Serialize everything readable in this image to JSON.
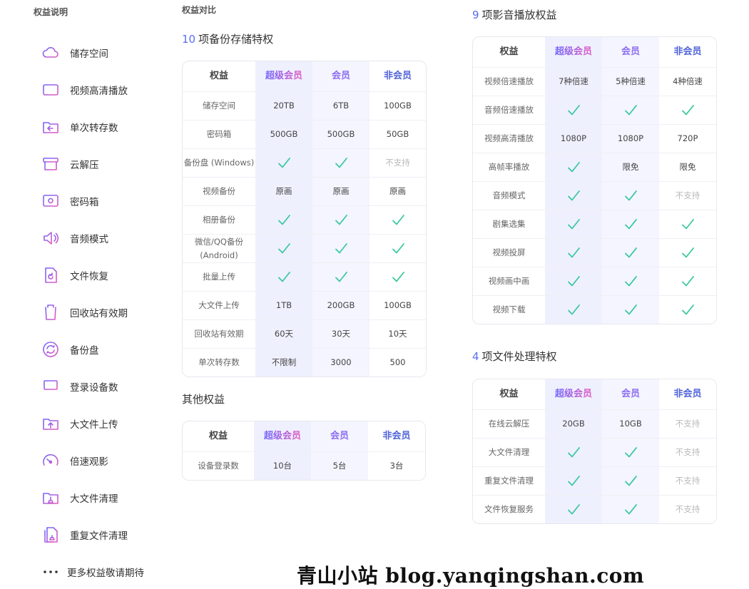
{
  "sidebar": {
    "title": "权益说明",
    "items": [
      {
        "icon": "cloud-icon",
        "label": "储存空间"
      },
      {
        "icon": "video-screen-icon",
        "label": "视频高清播放"
      },
      {
        "icon": "folder-transfer-icon",
        "label": "单次转存数"
      },
      {
        "icon": "archive-box-icon",
        "label": "云解压"
      },
      {
        "icon": "safe-box-icon",
        "label": "密码箱"
      },
      {
        "icon": "speaker-icon",
        "label": "音频模式"
      },
      {
        "icon": "file-restore-icon",
        "label": "文件恢复"
      },
      {
        "icon": "trash-icon",
        "label": "回收站有效期"
      },
      {
        "icon": "sync-icon",
        "label": "备份盘"
      },
      {
        "icon": "laptop-icon",
        "label": "登录设备数"
      },
      {
        "icon": "folder-upload-icon",
        "label": "大文件上传"
      },
      {
        "icon": "speedometer-icon",
        "label": "倍速观影"
      },
      {
        "icon": "folder-clean-icon",
        "label": "大文件清理"
      },
      {
        "icon": "file-duplicate-icon",
        "label": "重复文件清理"
      }
    ],
    "more": {
      "icon": "more-dots-icon",
      "label": "更多权益敬请期待"
    }
  },
  "compare": {
    "title": "权益对比",
    "headers": {
      "c0": "权益",
      "c1": "超级会员",
      "c2": "会员",
      "c3": "非会员"
    }
  },
  "storage": {
    "num": "10",
    "title": "项备份存储特权",
    "rows": [
      {
        "name": "储存空间",
        "v": [
          "20TB",
          "6TB",
          "100GB"
        ]
      },
      {
        "name": "密码箱",
        "v": [
          "500GB",
          "500GB",
          "50GB"
        ]
      },
      {
        "name": "备份盘 (Windows)",
        "v": [
          "✓",
          "✓",
          "不支持"
        ]
      },
      {
        "name": "视频备份",
        "v": [
          "原画",
          "原画",
          "原画"
        ]
      },
      {
        "name": "相册备份",
        "v": [
          "✓",
          "✓",
          "✓"
        ]
      },
      {
        "name": "微信/QQ备份\n(Android)",
        "v": [
          "✓",
          "✓",
          "✓"
        ]
      },
      {
        "name": "批量上传",
        "v": [
          "✓",
          "✓",
          "✓"
        ]
      },
      {
        "name": "大文件上传",
        "v": [
          "1TB",
          "200GB",
          "100GB"
        ]
      },
      {
        "name": "回收站有效期",
        "v": [
          "60天",
          "30天",
          "10天"
        ]
      },
      {
        "name": "单次转存数",
        "v": [
          "不限制",
          "3000",
          "500"
        ]
      }
    ]
  },
  "other": {
    "title": "其他权益",
    "rows": [
      {
        "name": "设备登录数",
        "v": [
          "10台",
          "5台",
          "3台"
        ]
      }
    ]
  },
  "media": {
    "num": "9",
    "title": "项影音播放权益",
    "rows": [
      {
        "name": "视频倍速播放",
        "v": [
          "7种倍速",
          "5种倍速",
          "4种倍速"
        ]
      },
      {
        "name": "音频倍速播放",
        "v": [
          "✓",
          "✓",
          "✓"
        ]
      },
      {
        "name": "视频高清播放",
        "v": [
          "1080P",
          "1080P",
          "720P"
        ]
      },
      {
        "name": "高帧率播放",
        "v": [
          "✓",
          "限免",
          "限免"
        ]
      },
      {
        "name": "音频模式",
        "v": [
          "✓",
          "✓",
          "不支持"
        ]
      },
      {
        "name": "剧集选集",
        "v": [
          "✓",
          "✓",
          "✓"
        ]
      },
      {
        "name": "视频投屏",
        "v": [
          "✓",
          "✓",
          "✓"
        ]
      },
      {
        "name": "视频画中画",
        "v": [
          "✓",
          "✓",
          "✓"
        ]
      },
      {
        "name": "视频下载",
        "v": [
          "✓",
          "✓",
          "✓"
        ]
      }
    ]
  },
  "files": {
    "num": "4",
    "title": "项文件处理特权",
    "rows": [
      {
        "name": "在线云解压",
        "v": [
          "20GB",
          "10GB",
          "不支持"
        ]
      },
      {
        "name": "大文件清理",
        "v": [
          "✓",
          "✓",
          "不支持"
        ]
      },
      {
        "name": "重复文件清理",
        "v": [
          "✓",
          "✓",
          "不支持"
        ]
      },
      {
        "name": "文件恢复服务",
        "v": [
          "✓",
          "✓",
          "不支持"
        ]
      }
    ]
  },
  "watermark": "青山小站 blog.yanqingshan.com",
  "colors": {
    "accent": "#5a6ef0",
    "check": "#3cc8a0",
    "icon_gradient": [
      "#6f66ff",
      "#e45bbf"
    ]
  }
}
